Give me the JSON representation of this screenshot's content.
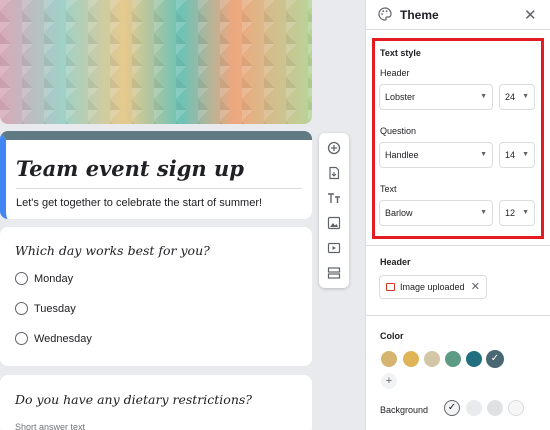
{
  "form": {
    "title": "Team event sign up",
    "description": "Let's get together to celebrate the start of summer!",
    "questions": [
      {
        "text": "Which day works best for you?",
        "options": [
          "Monday",
          "Tuesday",
          "Wednesday"
        ]
      },
      {
        "text": "Do you have any dietary restrictions?",
        "hint": "Short answer text"
      }
    ]
  },
  "toolbar": {
    "items": [
      "add-question",
      "import-questions",
      "add-title",
      "add-image",
      "add-video",
      "add-section"
    ]
  },
  "theme_panel": {
    "title": "Theme",
    "text_style": {
      "heading": "Text style",
      "header_label": "Header",
      "header_font": "Lobster",
      "header_size": "24",
      "question_label": "Question",
      "question_font": "Handlee",
      "question_size": "14",
      "text_label": "Text",
      "text_font": "Barlow",
      "text_size": "12"
    },
    "header_section": {
      "heading": "Header",
      "chip_label": "Image uploaded"
    },
    "color_section": {
      "heading": "Color",
      "swatches": [
        "#d4b46f",
        "#e0b357",
        "#d2c6a7",
        "#5c9c85",
        "#22707f",
        "#4a6774"
      ],
      "background_label": "Background",
      "background_swatches": [
        "#f1f3f4",
        "#e8eaed",
        "#dfe1e3",
        "#f6f6f6"
      ]
    }
  }
}
